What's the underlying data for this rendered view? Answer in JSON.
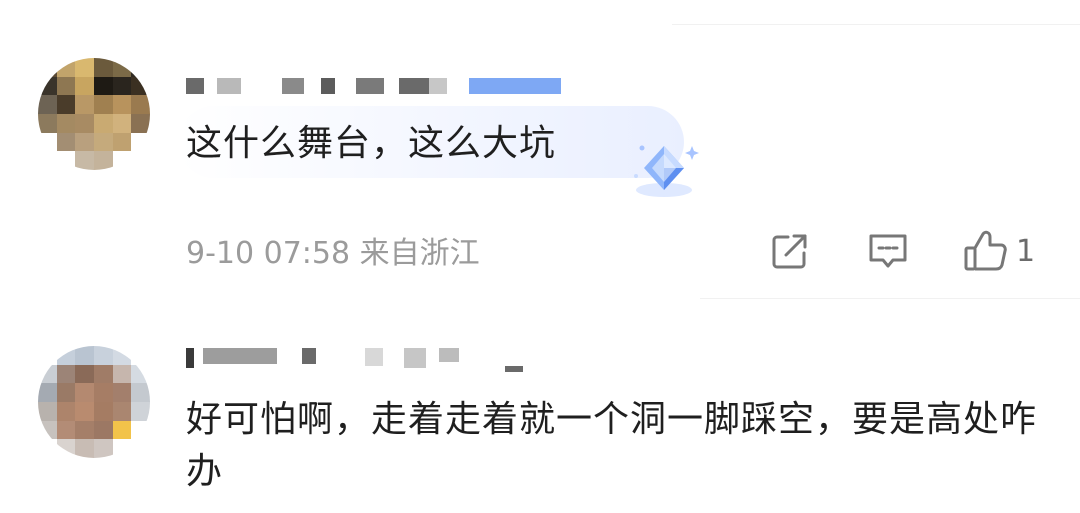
{
  "comments": [
    {
      "text": "这什么舞台，这么大坑",
      "time": "9-10 07:58",
      "location": "来自浙江",
      "like_count": "1"
    },
    {
      "text": "好可怕啊，走着走着就一个洞一脚踩空，要是高处咋办"
    }
  ],
  "icons": {
    "share": "share-icon",
    "reply": "comment-reply-icon",
    "like": "thumbs-up-icon",
    "badge": "diamond-badge-icon"
  },
  "colors": {
    "text": "#1f1f1f",
    "meta": "#9b9b9b",
    "bubble_tint": "#e9efff",
    "badge": "#6f9df6",
    "icon": "#777777"
  }
}
